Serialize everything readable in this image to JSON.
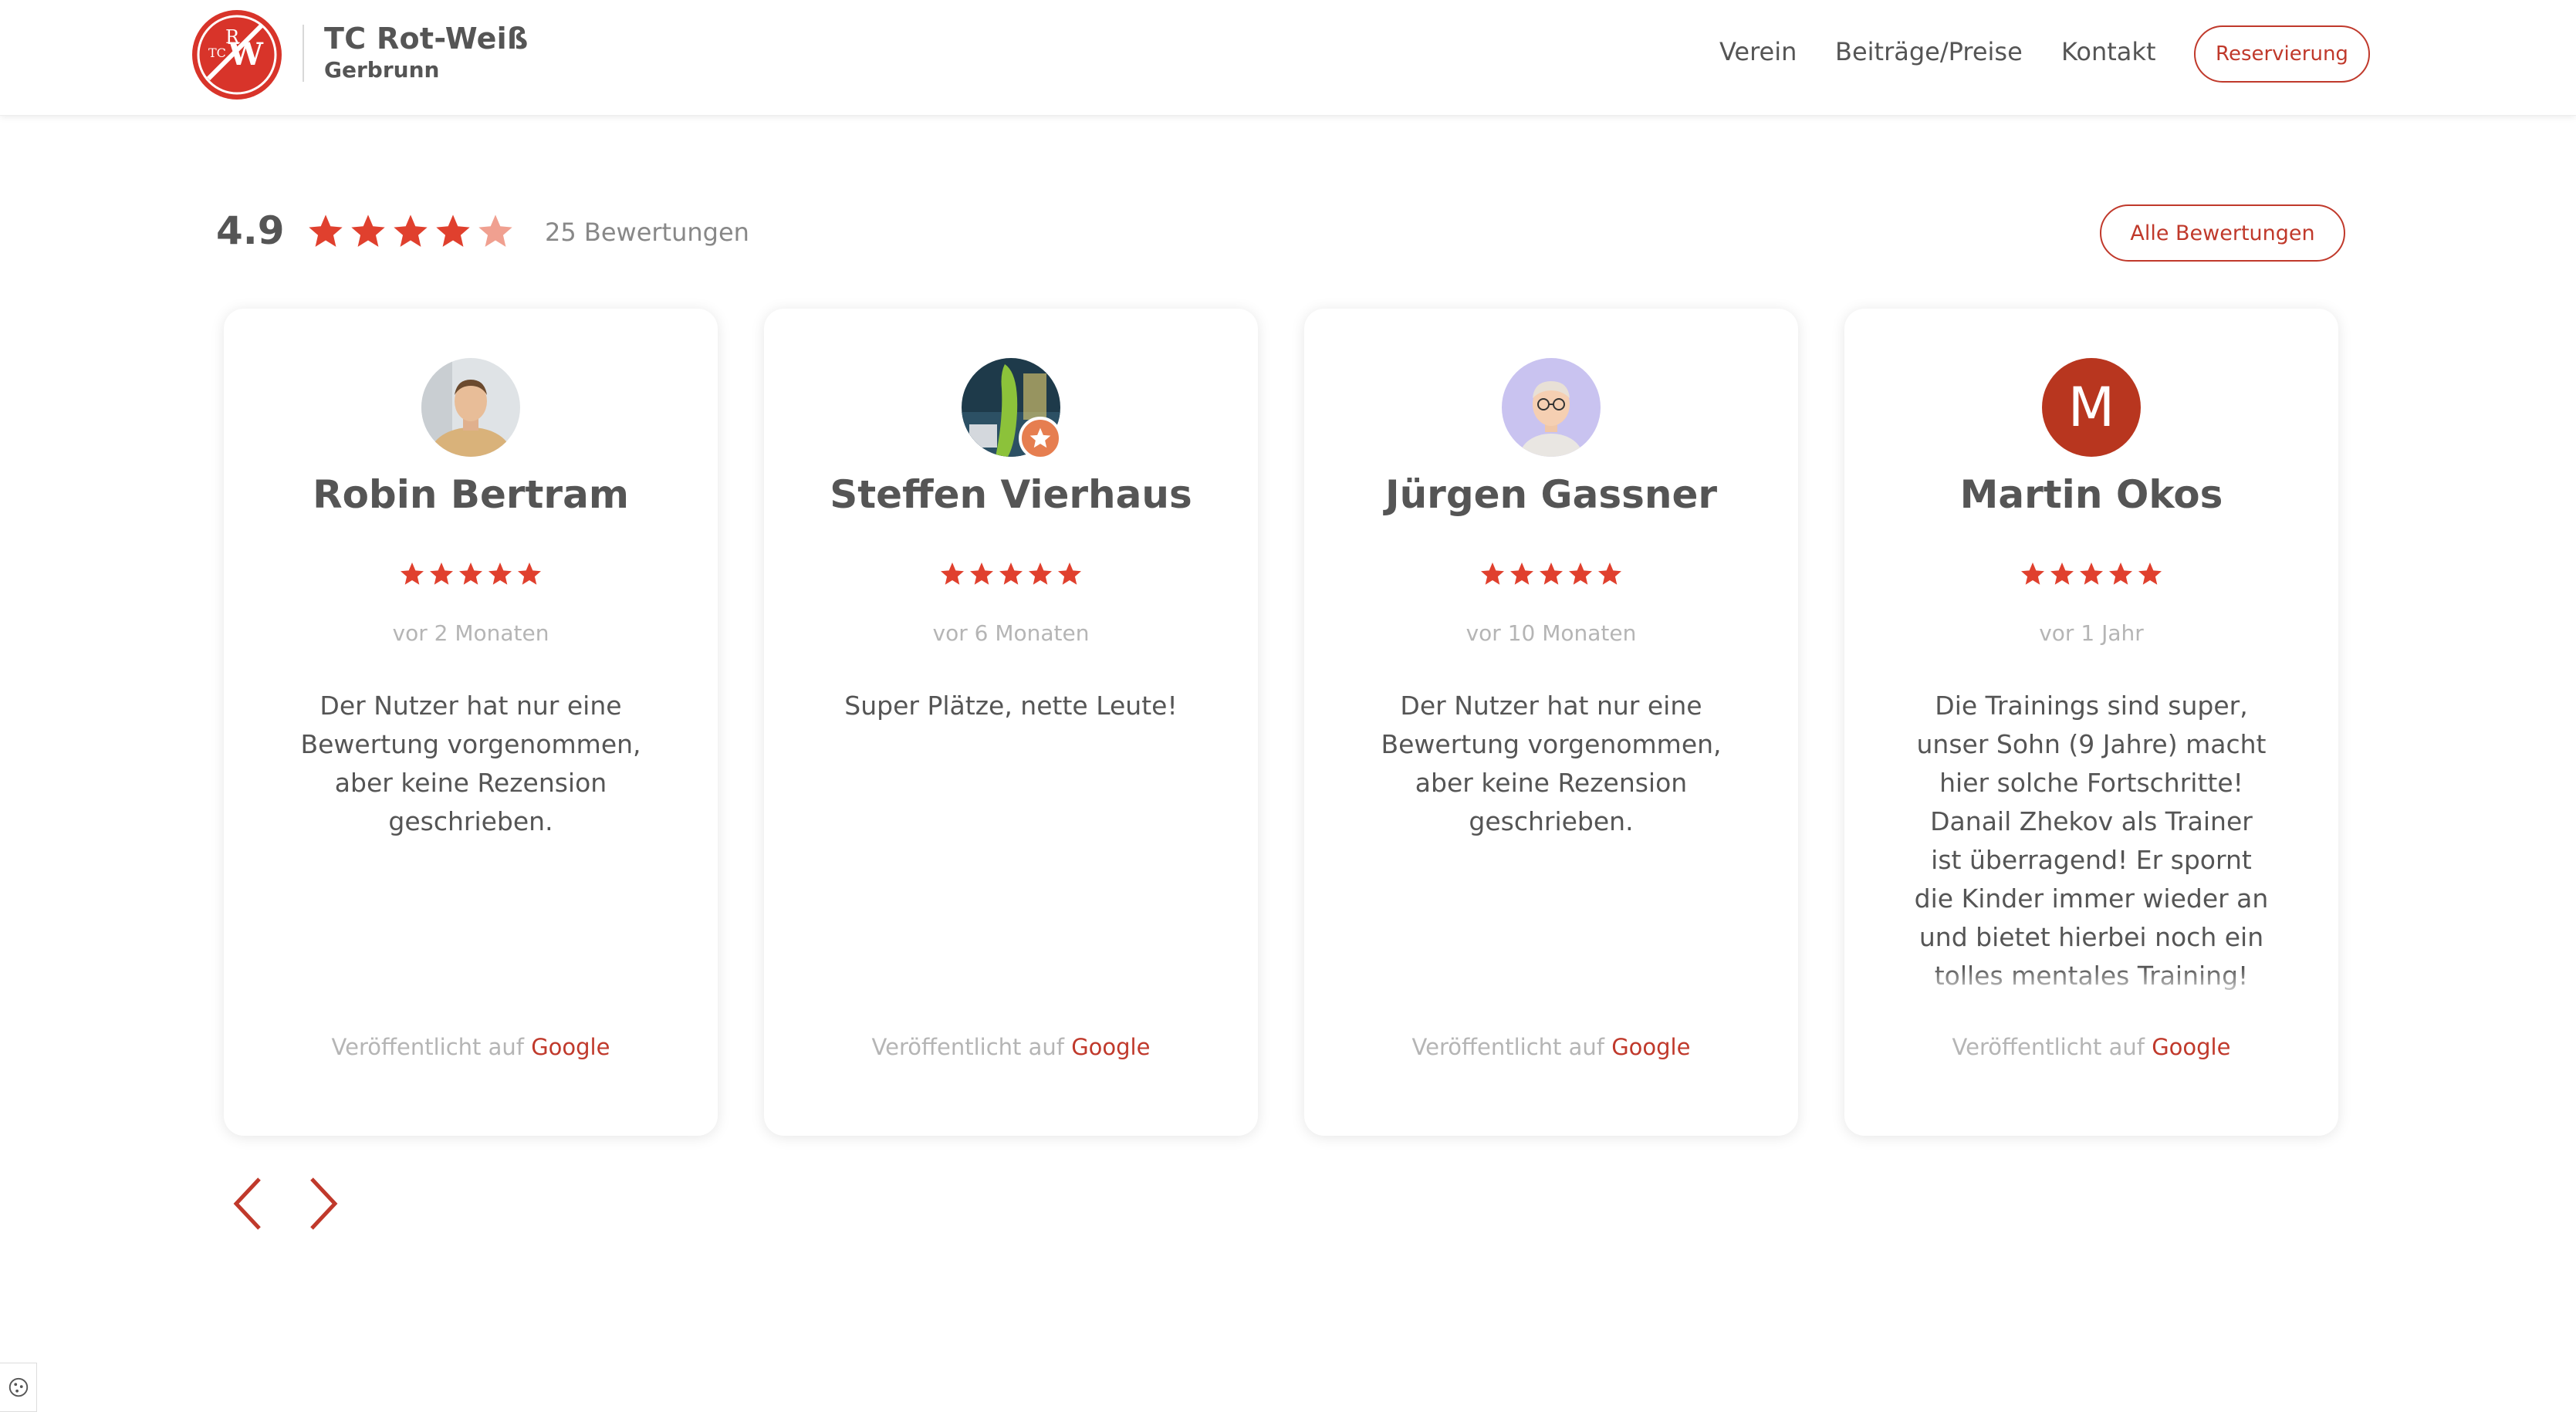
{
  "header": {
    "brand_title": "TC Rot-Weiß",
    "brand_subtitle": "Gerbrunn",
    "logo_icon": "club-logo-icon",
    "nav": [
      "Verein",
      "Beiträge/Preise",
      "Kontakt"
    ],
    "cta_label": "Reservierung"
  },
  "summary": {
    "rating": "4.9",
    "stars_filled": 4.5,
    "count_label": "25 Bewertungen",
    "all_reviews_label": "Alle Bewertungen"
  },
  "reviews": [
    {
      "name": "Robin Bertram",
      "stars": 5,
      "date": "vor 2 Monaten",
      "text": "Der Nutzer hat nur eine Bewertung vorgenommen, aber keine Rezension geschrieben.",
      "published_prefix": "Veröffentlicht auf",
      "published_source": "Google"
    },
    {
      "name": "Steffen Vierhaus",
      "stars": 5,
      "date": "vor 6 Monaten",
      "text": "Super Plätze, nette Leute!",
      "published_prefix": "Veröffentlicht auf",
      "published_source": "Google"
    },
    {
      "name": "Jürgen Gassner",
      "stars": 5,
      "date": "vor 10 Monaten",
      "text": "Der Nutzer hat nur eine Bewertung vorgenommen, aber keine Rezension geschrieben.",
      "published_prefix": "Veröffentlicht auf",
      "published_source": "Google"
    },
    {
      "name": "Martin Okos",
      "avatar_letter": "M",
      "stars": 5,
      "date": "vor 1 Jahr",
      "text": "Die Trainings sind super, unser Sohn (9 Jahre) macht hier solche Fortschritte! Danail Zhekov als Trainer ist überragend! Er spornt die Kinder immer wieder an und bietet hierbei noch ein tolles mentales Training! Ein Mann",
      "published_prefix": "Veröffentlicht auf",
      "published_source": "Google"
    }
  ],
  "colors": {
    "accent": "#c0392b",
    "star": "#e0402e",
    "star_faded": "#f0a090"
  }
}
